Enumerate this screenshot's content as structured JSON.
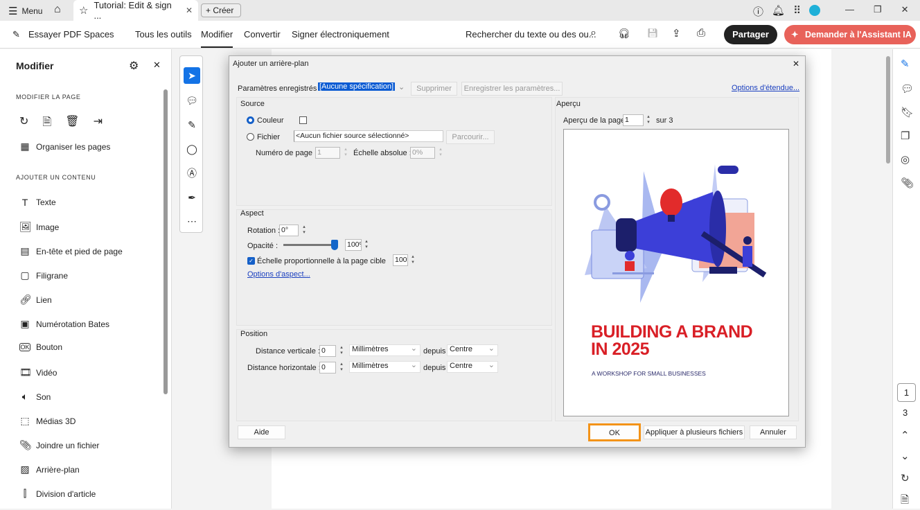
{
  "topbar": {
    "menu": "Menu",
    "tab_title": "Tutorial: Edit & sign ...",
    "create": "Créer"
  },
  "toolbar": {
    "spaces": "Essayer PDF Spaces",
    "nav": [
      "Tous les outils",
      "Modifier",
      "Convertir",
      "Signer électroniquement"
    ],
    "search": "Rechercher du texte ou des ou...",
    "share": "Partager",
    "ai": "Demander à l'Assistant IA",
    "ai_color": "#e8625a"
  },
  "left": {
    "title": "Modifier",
    "sec1": "MODIFIER LA PAGE",
    "organize": "Organiser les pages",
    "sec2": "AJOUTER UN CONTENU",
    "items": [
      "Texte",
      "Image",
      "En-tête et pied de page",
      "Filigrane",
      "Lien",
      "Numérotation Bates",
      "Bouton",
      "Vidéo",
      "Son",
      "Médias 3D",
      "Joindre un fichier",
      "Arrière-plan",
      "Division d'article"
    ]
  },
  "dialog": {
    "title": "Ajouter un arrière-plan",
    "saved_label": "Paramètres enregistrés :",
    "saved_value": "[Aucune spécification]",
    "delete": "Supprimer",
    "save_params": "Enregistrer les paramètres...",
    "options_link": "Options d'étendue...",
    "source": {
      "title": "Source",
      "color": "Couleur",
      "file": "Fichier",
      "file_value": "<Aucun fichier source sélectionné>",
      "browse": "Parcourir...",
      "page_num_label": "Numéro de page :",
      "page_num": "1",
      "abs_scale_label": "Échelle absolue :",
      "abs_scale": "0%"
    },
    "aspect": {
      "title": "Aspect",
      "rotation_label": "Rotation :",
      "rotation": "0°",
      "opacity_label": "Opacité :",
      "opacity": "100%",
      "opacity_fraction": 1.0,
      "scale_label": "Échelle proportionnelle à la page cible",
      "scale": "100%",
      "options_link": "Options d'aspect..."
    },
    "position": {
      "title": "Position",
      "vertical_label": "Distance verticale :",
      "horizontal_label": "Distance horizontale :",
      "vertical": "0",
      "horizontal": "0",
      "unit": "Millimètres",
      "from": "depuis",
      "anchor": "Centre"
    },
    "preview": {
      "title": "Aperçu",
      "page_label": "Aperçu de la page",
      "page": "1",
      "of": "sur 3",
      "heading1": "BUILDING A BRAND",
      "heading2": "IN 2025",
      "subtitle": "A WORKSHOP FOR SMALL BUSINESSES"
    },
    "help": "Aide",
    "ok": "OK",
    "apply_multi": "Appliquer à plusieurs fichiers",
    "cancel": "Annuler"
  },
  "pager": {
    "current": "1",
    "total": "3"
  }
}
